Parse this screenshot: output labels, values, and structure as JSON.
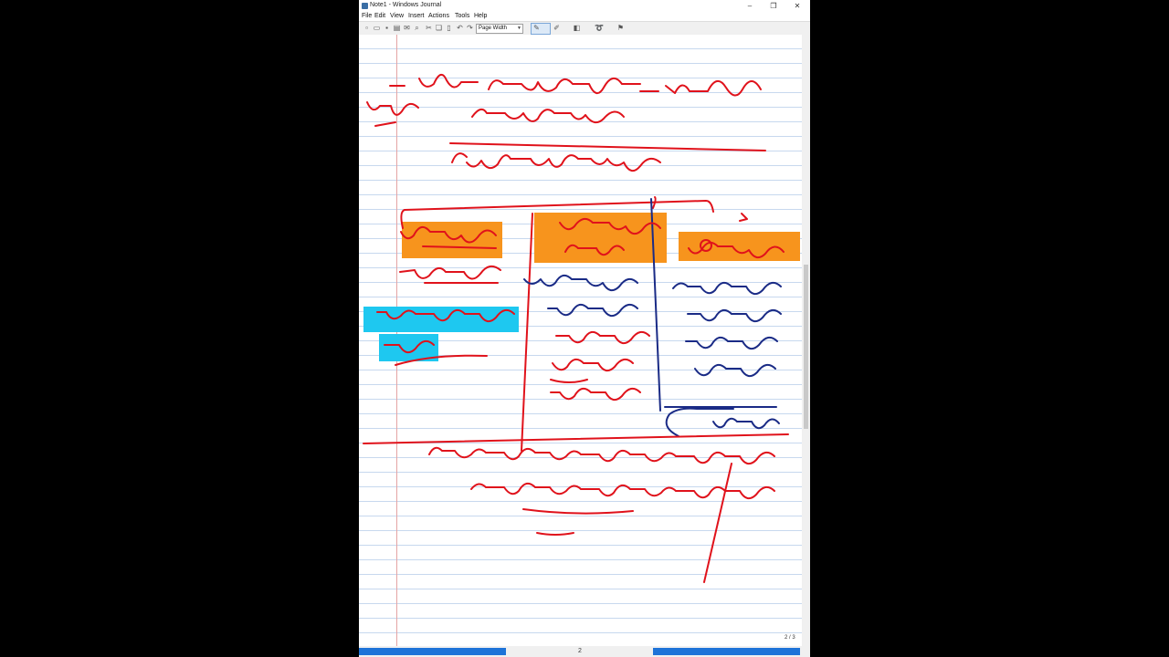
{
  "window": {
    "title": "Note1 - Windows Journal",
    "controls": [
      "minimize-icon",
      "restore-icon",
      "close-icon"
    ]
  },
  "menu": [
    "File",
    "Edit",
    "View",
    "Insert",
    "Actions",
    "Tools",
    "Help"
  ],
  "toolbar": {
    "zoom_value": "Page Width",
    "icons": [
      "new-note-icon",
      "open-icon",
      "save-icon",
      "print-icon",
      "email-icon",
      "search-icon",
      "cut-icon",
      "copy-icon",
      "paste-icon",
      "undo-icon",
      "redo-icon",
      "pen-icon",
      "highlighter-icon",
      "eraser-icon",
      "lasso-icon",
      "flag-icon"
    ]
  },
  "page_counter": "2 / 3",
  "status": {
    "page": "2"
  },
  "colors": {
    "ink_red": "#e0121b",
    "ink_blue": "#1a2b86",
    "highlight_orange": "#f7941d",
    "highlight_cyan": "#1ec8f0",
    "status_blue": "#1e73d8",
    "rule_line": "#c7d8ee",
    "margin_line": "#e5a4a4"
  }
}
